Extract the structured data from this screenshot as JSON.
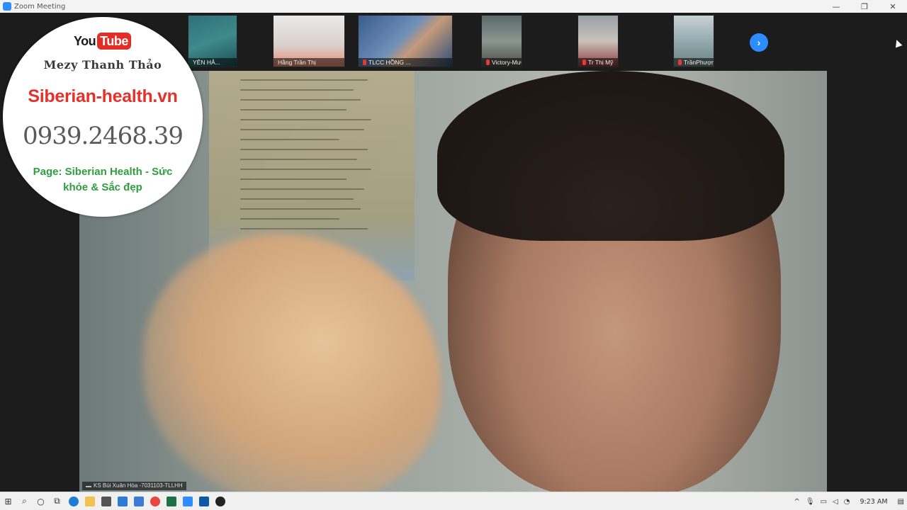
{
  "window": {
    "title": "Zoom Meeting",
    "controls": [
      "—",
      "❐",
      "✕"
    ]
  },
  "gallery": {
    "participants": [
      {
        "name": "YÊN HẢ..."
      },
      {
        "name": "Hằng Trần Thị"
      },
      {
        "name": "TLCC HỒNG ..."
      },
      {
        "name": "Victory-Mươn..."
      },
      {
        "name": "Tr Thị Mỹ"
      },
      {
        "name": "TrầnPhượng"
      }
    ],
    "next_icon": "chevron-right-icon"
  },
  "main_video": {
    "speaker_label": "KS Bùi Xuân Hòa -7031103-TLLHH"
  },
  "overlay": {
    "youtube_you": "You",
    "youtube_tube": "Tube",
    "owner": "Mezy Thanh Thảo",
    "site": "Siberian-health.vn",
    "phone": "0939.2468.39",
    "page": "Page: Siberian Health - Sức khỏe & Sắc đẹp",
    "colors": {
      "site": "#e4312b",
      "page": "#2e9e3e",
      "youtube": "#e52d27"
    }
  },
  "taskbar": {
    "clock": "9:23 AM",
    "icons": [
      "windows-start-icon",
      "search-icon",
      "cortana-icon",
      "task-view-icon",
      "edge-icon",
      "file-explorer-icon",
      "store-icon",
      "mail-icon",
      "calendar-icon",
      "chrome-icon",
      "excel-icon",
      "zoom-icon",
      "photos-icon",
      "obs-icon"
    ]
  }
}
